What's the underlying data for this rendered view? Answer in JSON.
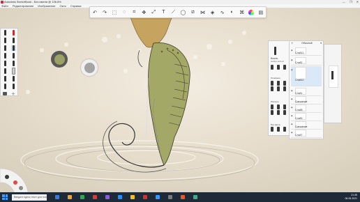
{
  "window": {
    "title": "Autodesk SketchBook - Без имени @ 136.8%",
    "controls": [
      "—",
      "❐",
      "✕"
    ]
  },
  "menu": {
    "items": [
      "Файл",
      "Редактирование",
      "Изображение",
      "Окно",
      "Справка"
    ]
  },
  "toolbar": {
    "tools": [
      {
        "name": "undo-icon",
        "glyph": "↶"
      },
      {
        "name": "redo-icon",
        "glyph": "↷"
      },
      {
        "name": "select-icon",
        "glyph": "⬚"
      },
      {
        "name": "lasso-icon",
        "glyph": "◌"
      },
      {
        "name": "crop-icon",
        "glyph": "⌗"
      },
      {
        "name": "transform-icon",
        "glyph": "✥"
      },
      {
        "name": "transform-alt-icon",
        "glyph": "⤢"
      },
      {
        "name": "text-icon",
        "glyph": "T"
      },
      {
        "name": "ruler-icon",
        "glyph": "⟋"
      },
      {
        "name": "ellipse-icon",
        "glyph": "◯"
      },
      {
        "name": "perspective-icon",
        "glyph": "⧄"
      },
      {
        "name": "symmetry-icon",
        "glyph": "⋈"
      },
      {
        "name": "fill-icon",
        "glyph": "◈"
      },
      {
        "name": "steady-stroke-icon",
        "glyph": "∿"
      },
      {
        "name": "copic-icon",
        "glyph": "◐"
      },
      {
        "name": "brush-library-icon",
        "glyph": "⌘"
      },
      {
        "name": "color-wheel-icon",
        "glyph": ""
      },
      {
        "name": "layers-icon",
        "glyph": "▤"
      }
    ]
  },
  "brush_panel": {
    "title": "Кисть",
    "subtitle": "Набор кистей",
    "section_basic": "Основное",
    "section_pastel": "Пастель",
    "section_nocolor": "Без цвета"
  },
  "layers_panel": {
    "blend_mode": "Обычный",
    "layers": [
      {
        "name": "Слой11",
        "selected": false
      },
      {
        "name": "Слой2",
        "selected": false
      },
      {
        "name": "Слой12",
        "selected": true
      },
      {
        "name": "Слой1",
        "selected": false
      },
      {
        "name": "Смешение",
        "selected": false
      },
      {
        "name": "Слой8",
        "selected": false
      },
      {
        "name": "Слой9",
        "selected": false
      },
      {
        "name": "Смешение",
        "selected": false
      },
      {
        "name": "Слой7",
        "selected": false
      }
    ]
  },
  "taskbar": {
    "search_placeholder": "Введите здесь текст для поиска",
    "time": "21:35",
    "date": "06.05.2021",
    "app_colors": [
      "#3a7bd5",
      "#e8a33d",
      "#2fa84f",
      "#d23c3c",
      "#8a5cd6",
      "#1e90ff",
      "#f0c020",
      "#cc3333",
      "#3399ff",
      "#7a7a7a",
      "#e05d2a",
      "#44aa88"
    ]
  },
  "colors": {
    "puck_fill": "#9ba164",
    "puck_secondary": "#a5a5a5",
    "seahorse_fill": "#a4a866"
  }
}
